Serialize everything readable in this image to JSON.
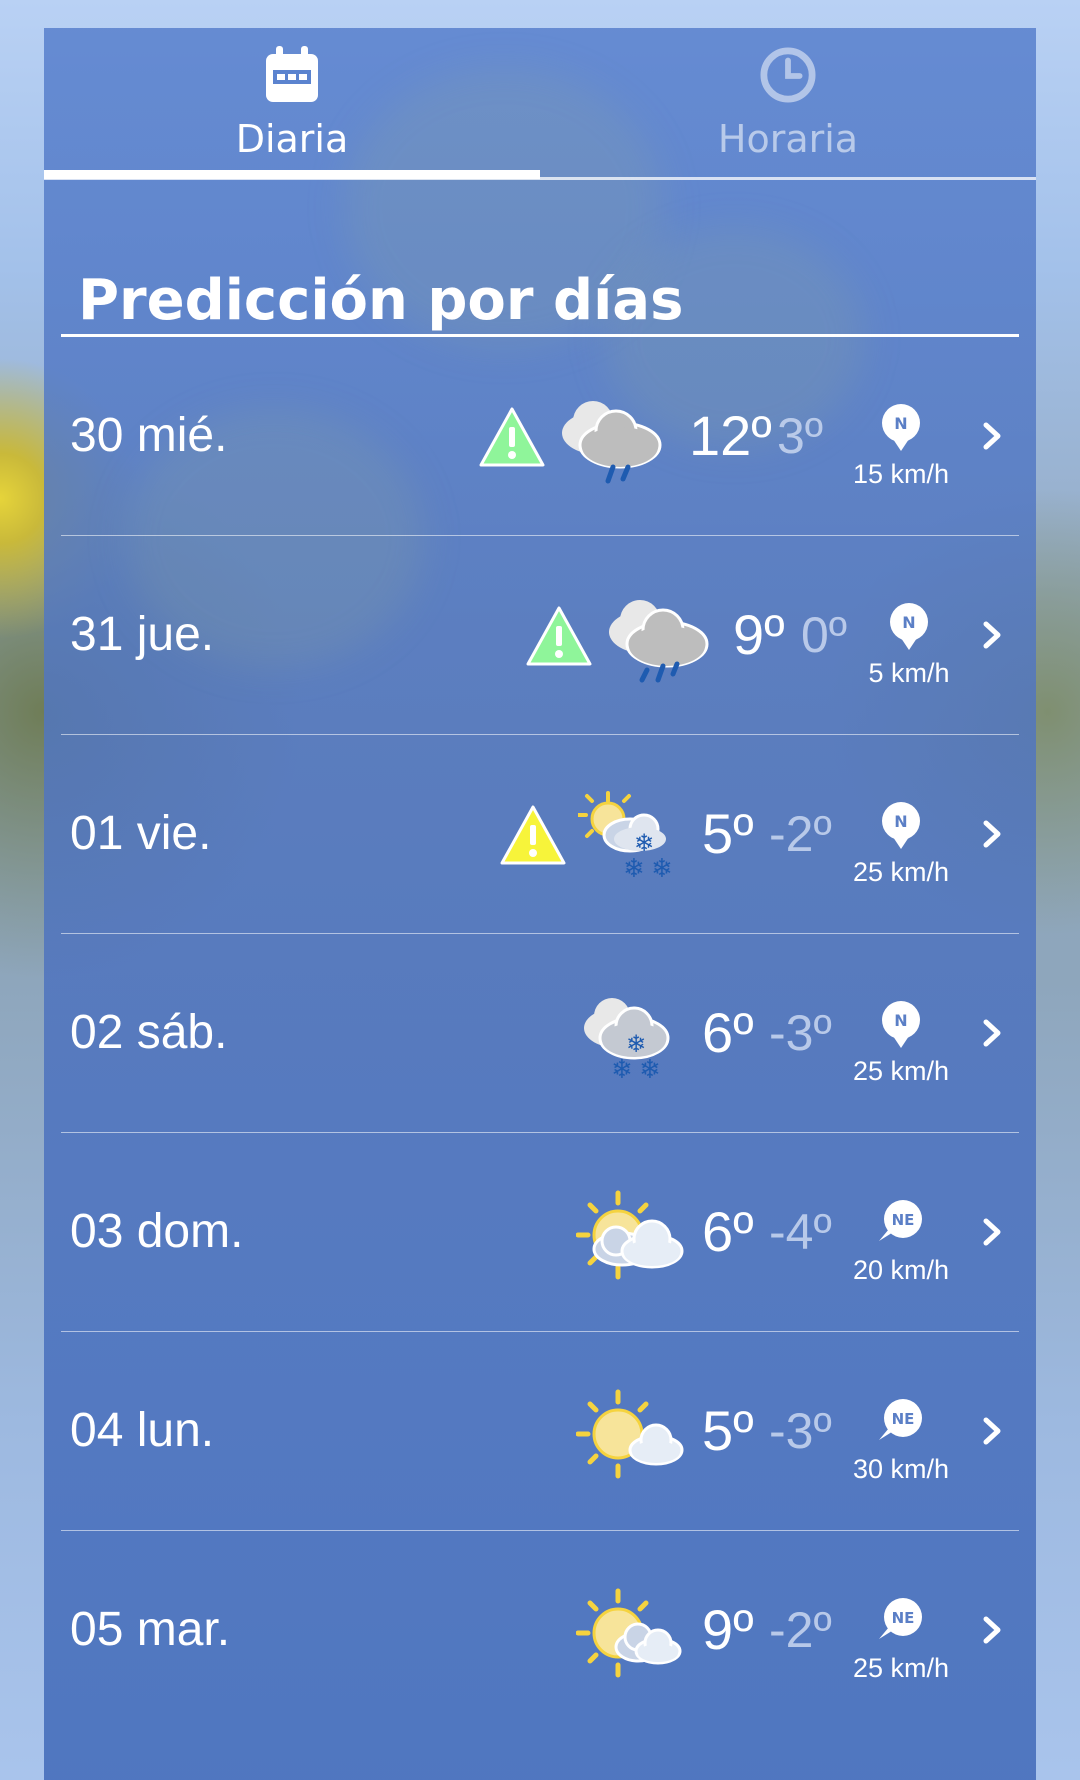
{
  "tabs": [
    {
      "label": "Diaria",
      "icon": "calendar-icon",
      "active": true
    },
    {
      "label": "Horaria",
      "icon": "clock-icon",
      "active": false
    }
  ],
  "section_title": "Predicción por días",
  "days": [
    {
      "day": "30 mié.",
      "warning": "green",
      "weather": "cloud-rain-icon",
      "max": "12º",
      "min": "3º",
      "wind_dir": "N",
      "wind_speed": "15 km/h"
    },
    {
      "day": "31 jue.",
      "warning": "green",
      "weather": "cloud-rain-icon",
      "max": "9º",
      "min": "0º",
      "wind_dir": "N",
      "wind_speed": "5 km/h"
    },
    {
      "day": "01 vie.",
      "warning": "yellow",
      "weather": "sun-cloud-snow-icon",
      "max": "5º",
      "min": "-2º",
      "wind_dir": "N",
      "wind_speed": "25 km/h"
    },
    {
      "day": "02 sáb.",
      "warning": "",
      "weather": "cloud-snow-icon",
      "max": "6º",
      "min": "-3º",
      "wind_dir": "N",
      "wind_speed": "25 km/h"
    },
    {
      "day": "03 dom.",
      "warning": "",
      "weather": "sun-clouds-icon",
      "max": "6º",
      "min": "-4º",
      "wind_dir": "NE",
      "wind_speed": "20 km/h"
    },
    {
      "day": "04 lun.",
      "warning": "",
      "weather": "sun-small-cloud-icon",
      "max": "5º",
      "min": "-3º",
      "wind_dir": "NE",
      "wind_speed": "30 km/h"
    },
    {
      "day": "05 mar.",
      "warning": "",
      "weather": "sun-clouds-icon",
      "max": "9º",
      "min": "-2º",
      "wind_dir": "NE",
      "wind_speed": "25 km/h"
    }
  ],
  "colors": {
    "warning_green": "#8ff59a",
    "warning_yellow": "#f7f43a",
    "sun": "#f5d33f",
    "rain": "#1e5bb0"
  }
}
